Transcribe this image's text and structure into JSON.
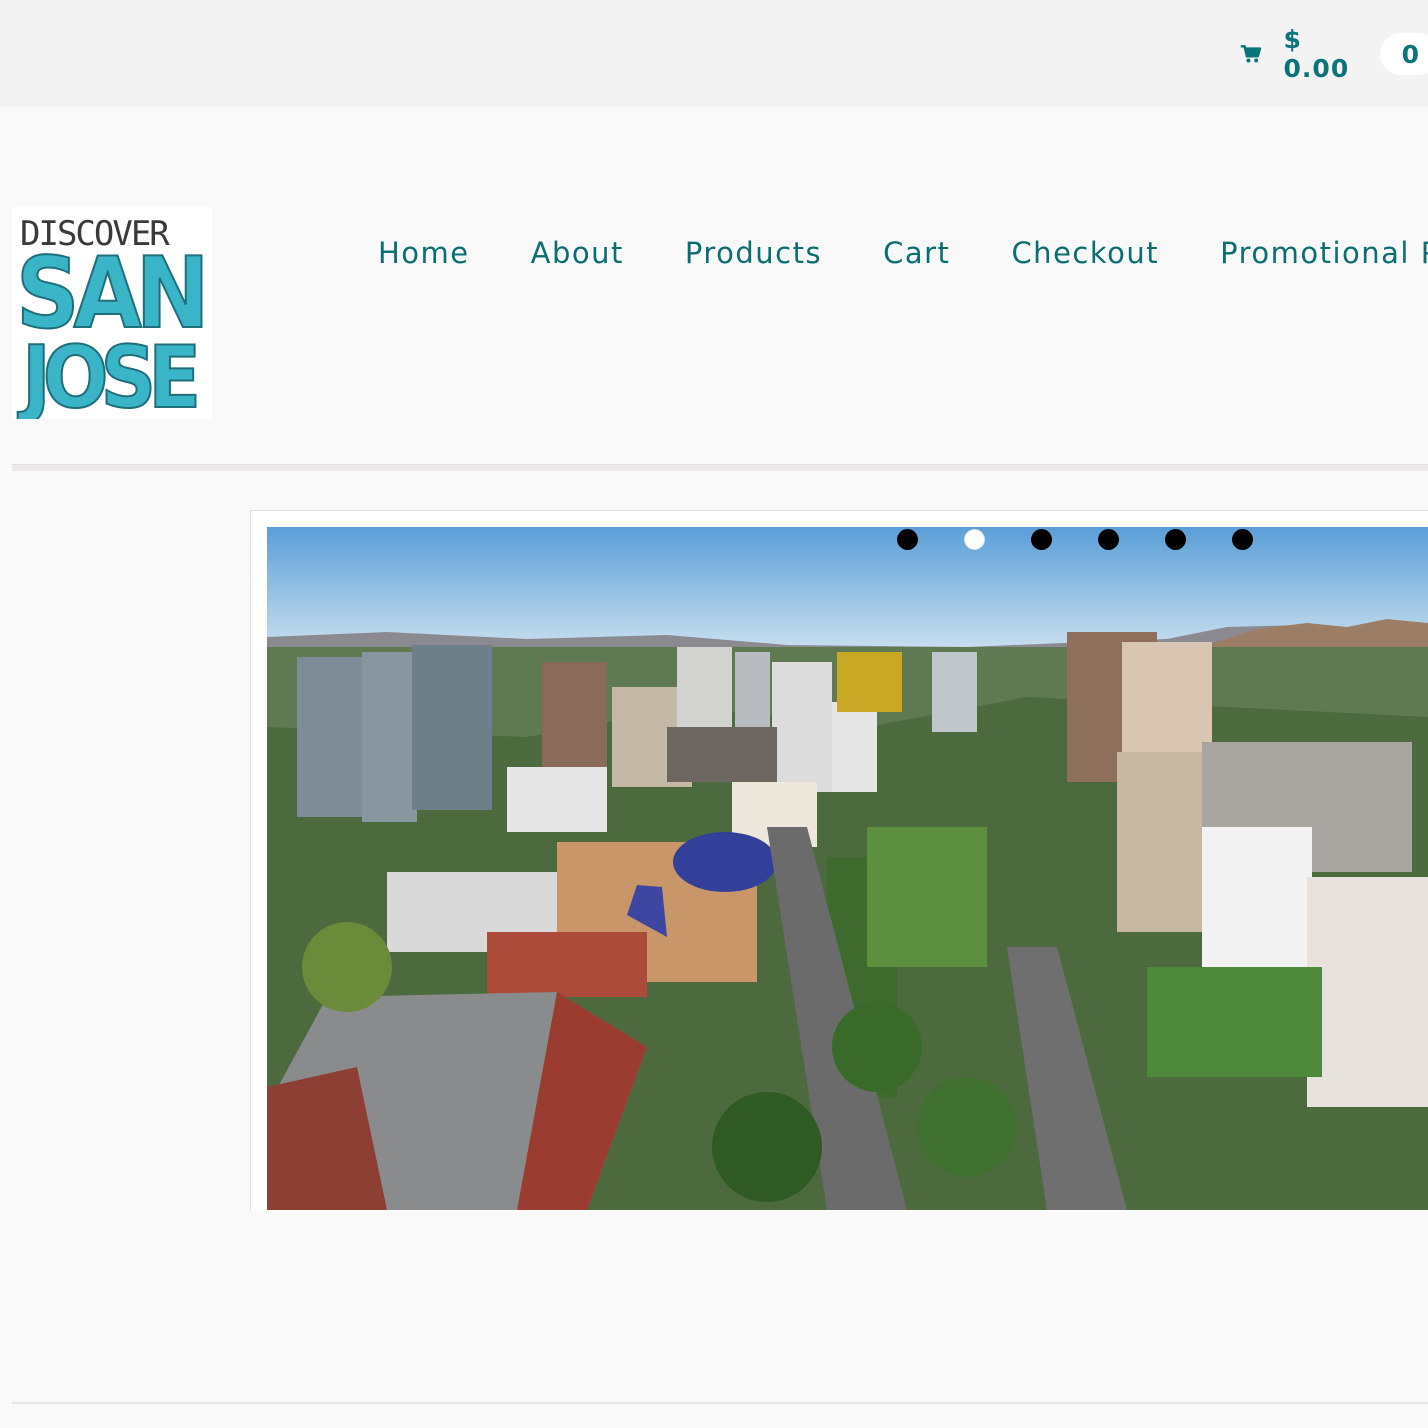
{
  "header": {
    "cart_total": "$ 0.00",
    "cart_count": "0",
    "cart_icon": "shopping-cart-icon",
    "accent_color": "#0b7479"
  },
  "logo": {
    "line1": "DISCOVER",
    "line2": "SAN",
    "line3": "JOSE",
    "colors": {
      "text_dark": "#333333",
      "text_accent": "#3ab5c8"
    }
  },
  "nav": {
    "items": [
      {
        "label": "Home"
      },
      {
        "label": "About"
      },
      {
        "label": "Products"
      },
      {
        "label": "Cart"
      },
      {
        "label": "Checkout"
      },
      {
        "label": "Promotional Pro"
      }
    ]
  },
  "slider": {
    "image": "aerial-city-skyline-image",
    "dots": 6,
    "active_dot": 2
  }
}
